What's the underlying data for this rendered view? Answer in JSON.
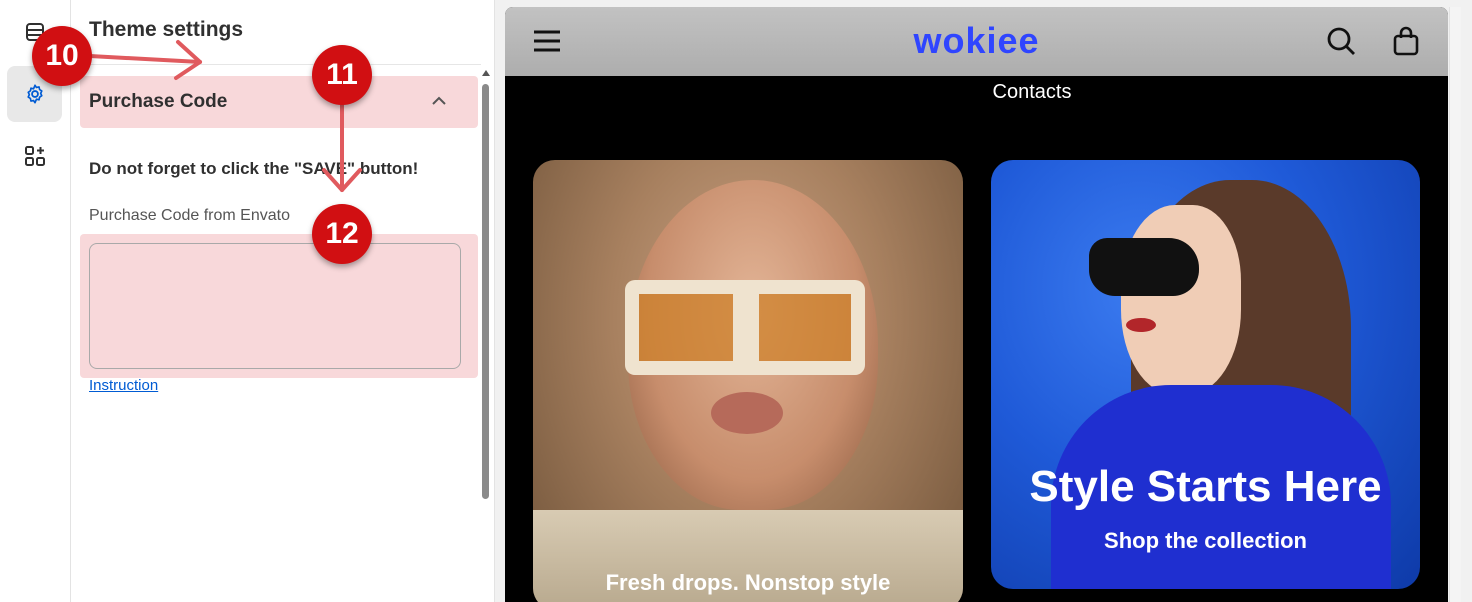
{
  "rail": {
    "items": [
      {
        "icon": "layout-icon",
        "active": false
      },
      {
        "icon": "gear-icon",
        "active": true
      },
      {
        "icon": "apps-add-icon",
        "active": false
      }
    ]
  },
  "panel": {
    "title": "Theme settings",
    "section": {
      "title": "Purchase Code",
      "expanded": true
    },
    "reminder": "Do not forget to click the \"SAVE\" button!",
    "field_label": "Purchase Code from Envato",
    "field_value": "",
    "instruction_link": "Instruction"
  },
  "preview": {
    "logo": "wokiee",
    "nav_item": "Contacts",
    "hero_left": {
      "caption": "Fresh drops. Nonstop style"
    },
    "hero_right": {
      "title": "Style Starts Here",
      "subtitle": "Shop the collection"
    }
  },
  "markers": {
    "m10": "10",
    "m11": "11",
    "m12": "12",
    "color": "#d10f12"
  },
  "colors": {
    "highlight": "#f8d8da",
    "logo": "#2f45ff",
    "link": "#005bd3"
  }
}
